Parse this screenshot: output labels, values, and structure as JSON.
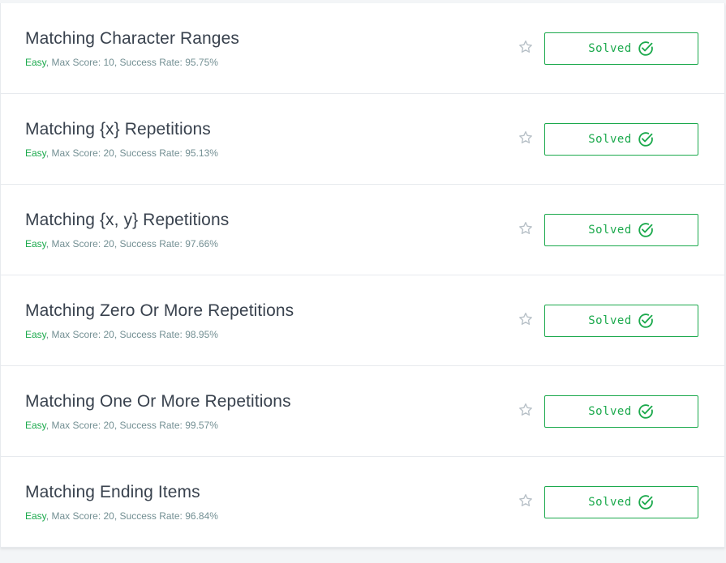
{
  "challenges": [
    {
      "title": "Matching Character Ranges",
      "difficulty": "Easy",
      "max_score": "Max Score: 10",
      "success_rate": "Success Rate: 95.75%",
      "status": "Solved"
    },
    {
      "title": "Matching {x} Repetitions",
      "difficulty": "Easy",
      "max_score": "Max Score: 20",
      "success_rate": "Success Rate: 95.13%",
      "status": "Solved"
    },
    {
      "title": "Matching {x, y} Repetitions",
      "difficulty": "Easy",
      "max_score": "Max Score: 20",
      "success_rate": "Success Rate: 97.66%",
      "status": "Solved"
    },
    {
      "title": "Matching Zero Or More Repetitions",
      "difficulty": "Easy",
      "max_score": "Max Score: 20",
      "success_rate": "Success Rate: 98.95%",
      "status": "Solved"
    },
    {
      "title": "Matching One Or More Repetitions",
      "difficulty": "Easy",
      "max_score": "Max Score: 20",
      "success_rate": "Success Rate: 99.57%",
      "status": "Solved"
    },
    {
      "title": "Matching Ending Items",
      "difficulty": "Easy",
      "max_score": "Max Score: 20",
      "success_rate": "Success Rate: 96.84%",
      "status": "Solved"
    }
  ],
  "icons": {
    "bookmark": "star-outline-icon",
    "solved": "check-circle-icon"
  },
  "colors": {
    "accent_green": "#1ba94c",
    "title_text": "#39424e",
    "meta_text": "#738f93",
    "star": "#b7c0c7"
  }
}
